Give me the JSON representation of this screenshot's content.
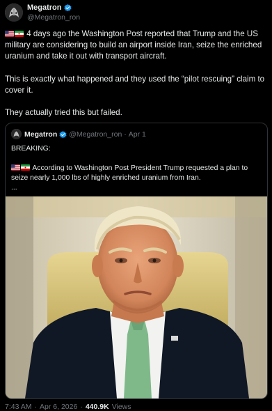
{
  "post": {
    "author": {
      "name": "Megatron",
      "handle": "@Megatron_ron",
      "verified": true
    },
    "paragraphs": [
      "4 days ago the Washington Post reported that Trump and the US military are considering to build an airport inside Iran, seize the enriched uranium and take it out with transport aircraft.",
      "This is exactly what happened and they used the “pilot rescuing” claim to cover it.",
      "They actually tried this but failed."
    ],
    "flags": [
      "us-flag-icon",
      "iran-flag-icon"
    ],
    "footer": {
      "time": "7:43 AM",
      "separator": "·",
      "date": "Apr 6, 2026",
      "views_count": "440.9K",
      "views_label": "Views"
    }
  },
  "quote": {
    "author": {
      "name": "Megatron",
      "handle": "@Megatron_ron",
      "separator": "·",
      "date": "Apr 1"
    },
    "headline": "BREAKING:",
    "text": "According to Washington Post President Trump requested a plan to seize nearly 1,000 lbs of highly enriched uranium from Iran.",
    "ellipsis": "..."
  },
  "colors": {
    "background": "#000000",
    "text": "#e7e9ea",
    "secondary_text": "#71767b",
    "border": "#2f3336",
    "verified": "#1d9bf0"
  }
}
